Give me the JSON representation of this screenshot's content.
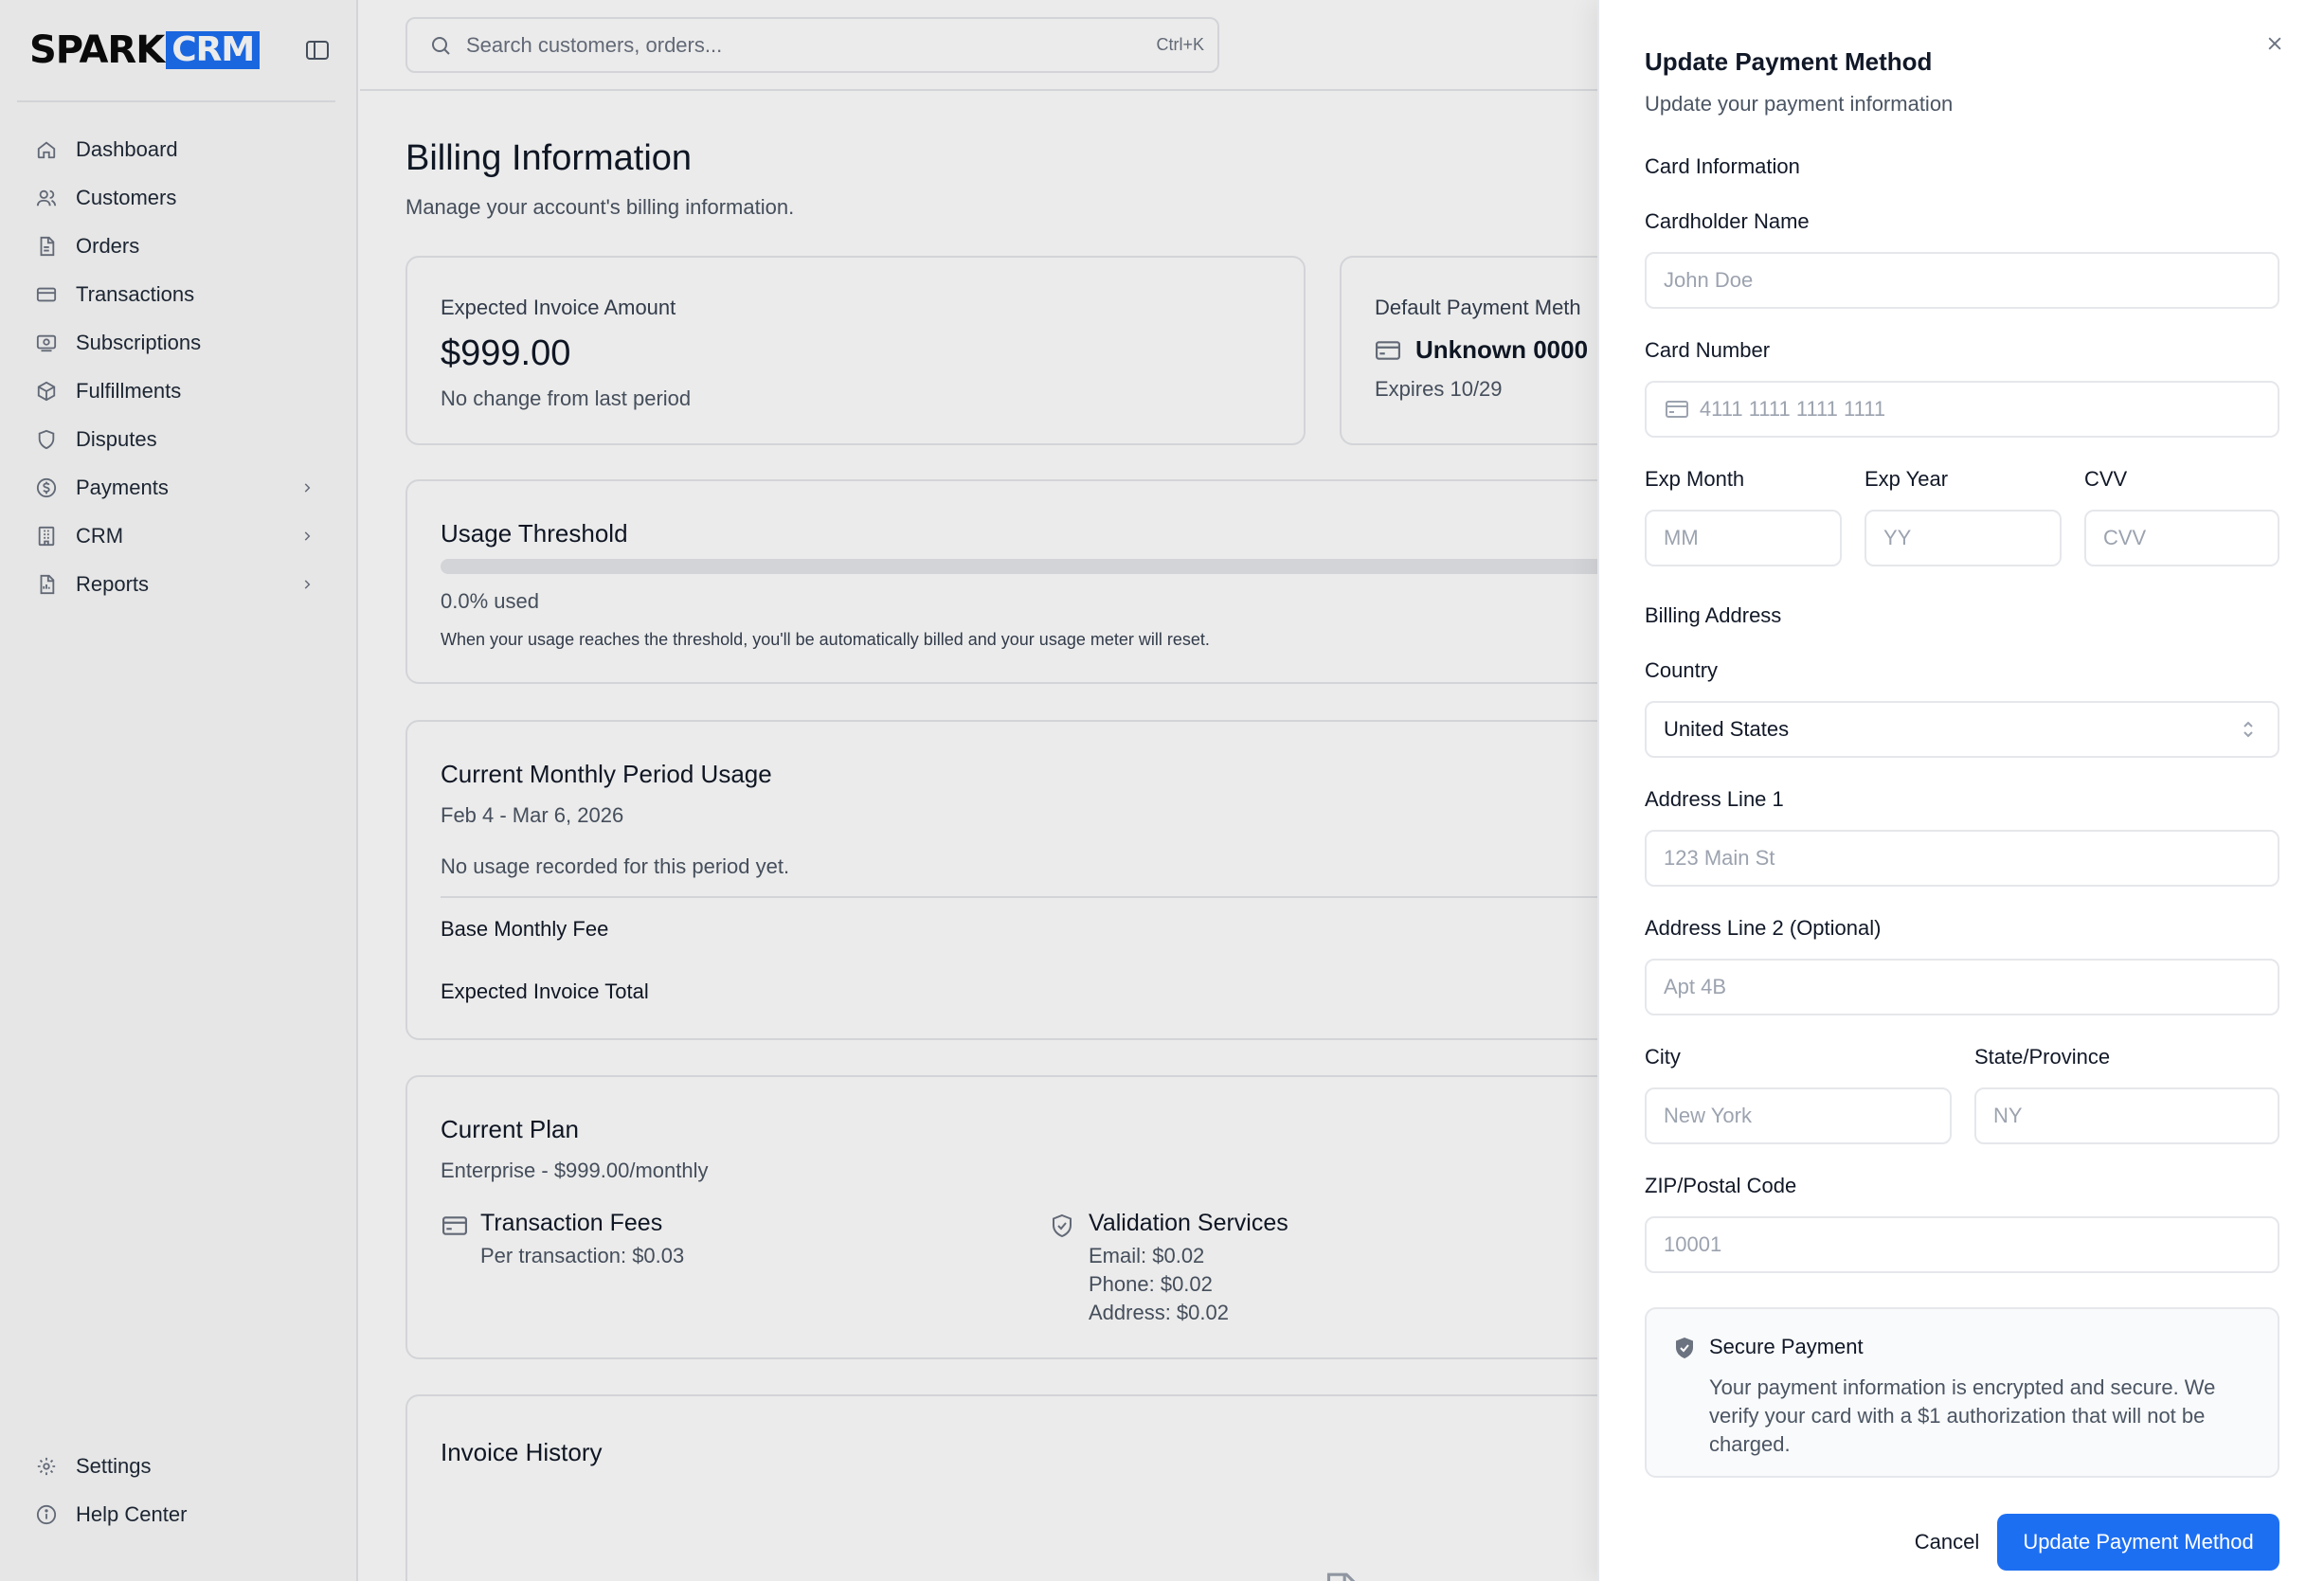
{
  "app": {
    "logo_text": "SPARK",
    "logo_badge": "CRM",
    "brand_color": "#1d6ff2"
  },
  "sidebar": {
    "items": [
      {
        "label": "Dashboard",
        "icon": "home-icon"
      },
      {
        "label": "Customers",
        "icon": "users-icon"
      },
      {
        "label": "Orders",
        "icon": "file-icon"
      },
      {
        "label": "Transactions",
        "icon": "credit-card-icon"
      },
      {
        "label": "Subscriptions",
        "icon": "subscription-icon"
      },
      {
        "label": "Fulfillments",
        "icon": "box-icon"
      },
      {
        "label": "Disputes",
        "icon": "shield-icon"
      },
      {
        "label": "Payments",
        "icon": "dollar-circle-icon",
        "has_submenu": true
      },
      {
        "label": "CRM",
        "icon": "building-icon",
        "has_submenu": true
      },
      {
        "label": "Reports",
        "icon": "report-icon",
        "has_submenu": true
      }
    ],
    "footer_items": [
      {
        "label": "Settings",
        "icon": "gear-icon"
      },
      {
        "label": "Help Center",
        "icon": "info-icon"
      }
    ]
  },
  "topbar": {
    "search_placeholder": "Search customers, orders...",
    "search_shortcut": "Ctrl+K"
  },
  "page": {
    "title": "Billing Information",
    "subtitle": "Manage your account's billing information."
  },
  "invoice_card": {
    "label": "Expected Invoice Amount",
    "amount": "$999.00",
    "note": "No change from last period"
  },
  "payment_card": {
    "label": "Default Payment Meth",
    "card": "Unknown 0000",
    "expires": "Expires 10/29"
  },
  "usage_card": {
    "title": "Usage Threshold",
    "used_percent": 0.0,
    "used_label": "0.0% used",
    "note": "When your usage reaches the threshold, you'll be automatically billed and your usage meter will reset."
  },
  "period_card": {
    "title": "Current Monthly Period Usage",
    "range": "Feb 4 - Mar 6, 2026",
    "empty": "No usage recorded for this period yet.",
    "base_fee_label": "Base Monthly Fee",
    "total_label": "Expected Invoice Total"
  },
  "plan_card": {
    "title": "Current Plan",
    "plan": "Enterprise - $999.00/monthly",
    "fees_title": "Transaction Fees",
    "fees_line": "Per transaction: $0.03",
    "validation_title": "Validation Services",
    "validation_email": "Email: $0.02",
    "validation_phone": "Phone: $0.02",
    "validation_address": "Address: $0.02"
  },
  "invoice_history": {
    "title": "Invoice History"
  },
  "drawer": {
    "title": "Update Payment Method",
    "subtitle": "Update your payment information",
    "card_section": "Card Information",
    "cardholder_label": "Cardholder Name",
    "cardholder_placeholder": "John Doe",
    "card_number_label": "Card Number",
    "card_number_placeholder": "4111 1111 1111 1111",
    "exp_month_label": "Exp Month",
    "exp_month_placeholder": "MM",
    "exp_year_label": "Exp Year",
    "exp_year_placeholder": "YY",
    "cvv_label": "CVV",
    "cvv_placeholder": "CVV",
    "billing_section": "Billing Address",
    "country_label": "Country",
    "country_value": "United States",
    "address1_label": "Address Line 1",
    "address1_placeholder": "123 Main St",
    "address2_label": "Address Line 2 (Optional)",
    "address2_placeholder": "Apt 4B",
    "city_label": "City",
    "city_placeholder": "New York",
    "state_label": "State/Province",
    "state_placeholder": "NY",
    "zip_label": "ZIP/Postal Code",
    "zip_placeholder": "10001",
    "secure_title": "Secure Payment",
    "secure_desc": "Your payment information is encrypted and secure. We verify your card with a $1 authorization that will not be charged.",
    "cancel_label": "Cancel",
    "submit_label": "Update Payment Method"
  }
}
